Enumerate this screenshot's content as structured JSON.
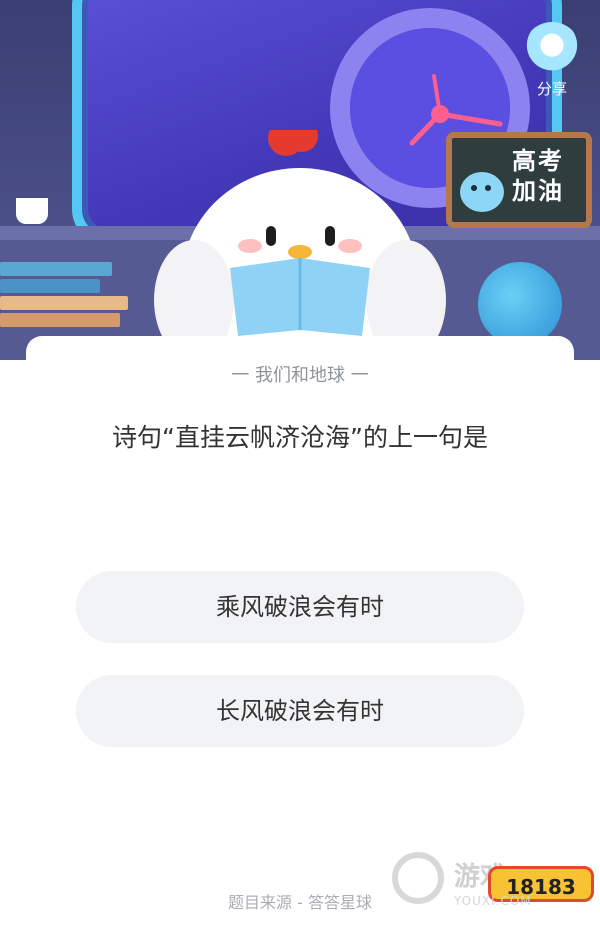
{
  "hero": {
    "share_label": "分享",
    "board_text": "高考加油",
    "board_line1": "高考",
    "board_line2": "加油"
  },
  "quiz": {
    "topic": "一 我们和地球 一",
    "question": "诗句“直挂云帆济沧海”的上一句是",
    "options": [
      {
        "label": "乘风破浪会有时"
      },
      {
        "label": "长风破浪会有时"
      }
    ],
    "source": "题目来源 - 答答星球"
  },
  "watermark": {
    "brand": "游戏3",
    "badge": "18183",
    "url": "YOUXI.COM"
  },
  "colors": {
    "card_bg": "#ffffff",
    "option_bg": "#f2f3f5",
    "hero_bg": "#3a3e73",
    "window_border": "#54c7f3"
  }
}
